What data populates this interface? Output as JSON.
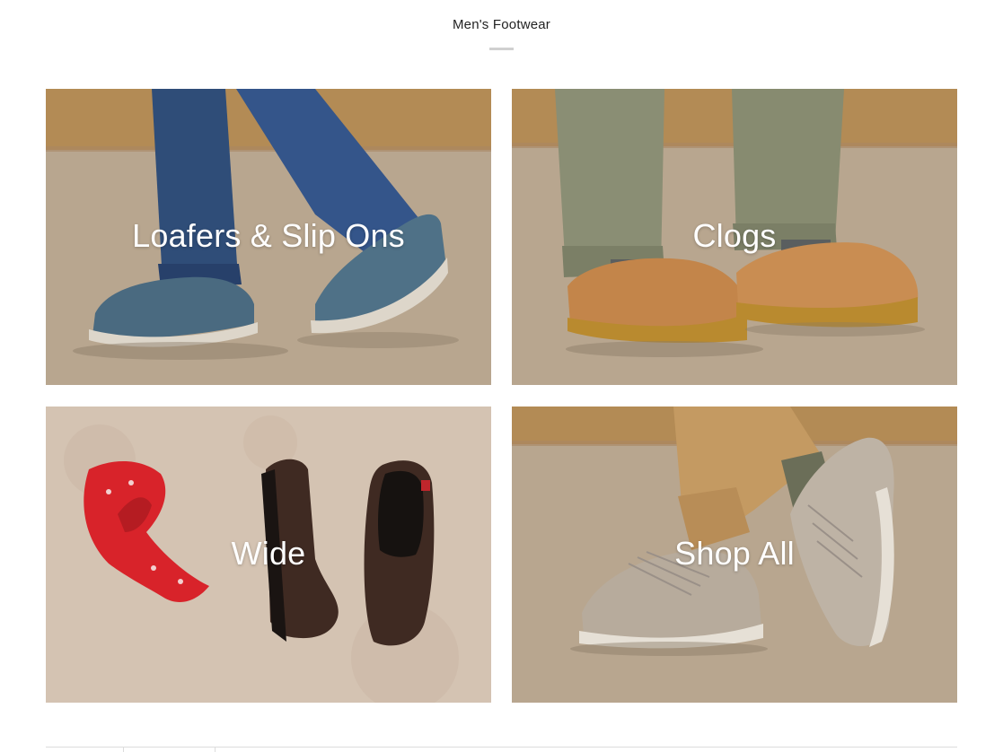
{
  "section": {
    "title": "Men's Footwear"
  },
  "tiles": [
    {
      "label": "Loafers & Slip Ons",
      "icon": "blue-slip-on-shoes-photo"
    },
    {
      "label": "Clogs",
      "icon": "tan-leather-clogs-photo"
    },
    {
      "label": "Wide",
      "icon": "brown-clogs-and-bandana-photo"
    },
    {
      "label": "Shop All",
      "icon": "grey-suede-sneakers-photo"
    }
  ],
  "colors": {
    "wall": "#b8935e",
    "floor": "#b8a68f",
    "denim": "#2f4d78",
    "olive": "#8a8e74",
    "khaki": "#c49a62",
    "blue_shoe": "#4a6a80",
    "tan_clog": "#c3854a",
    "brown_clog": "#3f2a22",
    "bandana": "#d8232a",
    "grey_sneaker": "#b7ab9c",
    "label_text": "#ffffff"
  }
}
